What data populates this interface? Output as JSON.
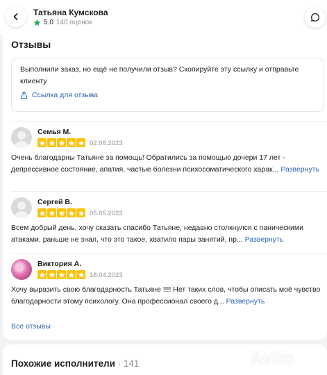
{
  "header": {
    "name": "Татьяна Кумскова",
    "rating": "5.0",
    "reviews_count": "140 оценок",
    "back_icon": "chevron-left-icon",
    "chat_icon": "chat-bubble-icon"
  },
  "reviews_section": {
    "title": "Отзывы",
    "info_text": "Выполнили заказ, но ещё не получили отзыв? Скопируйте эту ссылку и отправьте клиенту",
    "link_label": "Ссылка для отзыва",
    "items": [
      {
        "name": "Семья М.",
        "stars": 5,
        "date": "02.06.2023",
        "text": "Очень благодарны Татьяне за помощь! Обратились за помощью дочери 17 лет - депрессивное состояние, апатия, частые болезни психосоматического харак...",
        "expand": "Развернуть"
      },
      {
        "name": "Сергей В.",
        "stars": 5,
        "date": "05.05.2023",
        "text": "Всем добрый день, хочу сказать спасибо Татьяне, недавно столкнулся с паническими атаками, раньше не знал, что это такое, хватило пары занятий, пр...",
        "expand": "Развернуть"
      },
      {
        "name": "Виктория А.",
        "stars": 5,
        "date": "18.04.2023",
        "text": "Хочу выразить свою благодарность Татьяне !!!! Нет таких слов, чтобы описать моё чувство благодарности этому психологу. Она профессионал своего д...",
        "expand": "Развернуть"
      }
    ],
    "all_reviews": "Все отзывы"
  },
  "similar": {
    "title": "Похожие исполнители",
    "count": "· 141"
  },
  "watermark": "Avito",
  "colors": {
    "accent_link": "#2a64b6",
    "star": "#fcc20d",
    "rating_star": "#24a84d"
  }
}
